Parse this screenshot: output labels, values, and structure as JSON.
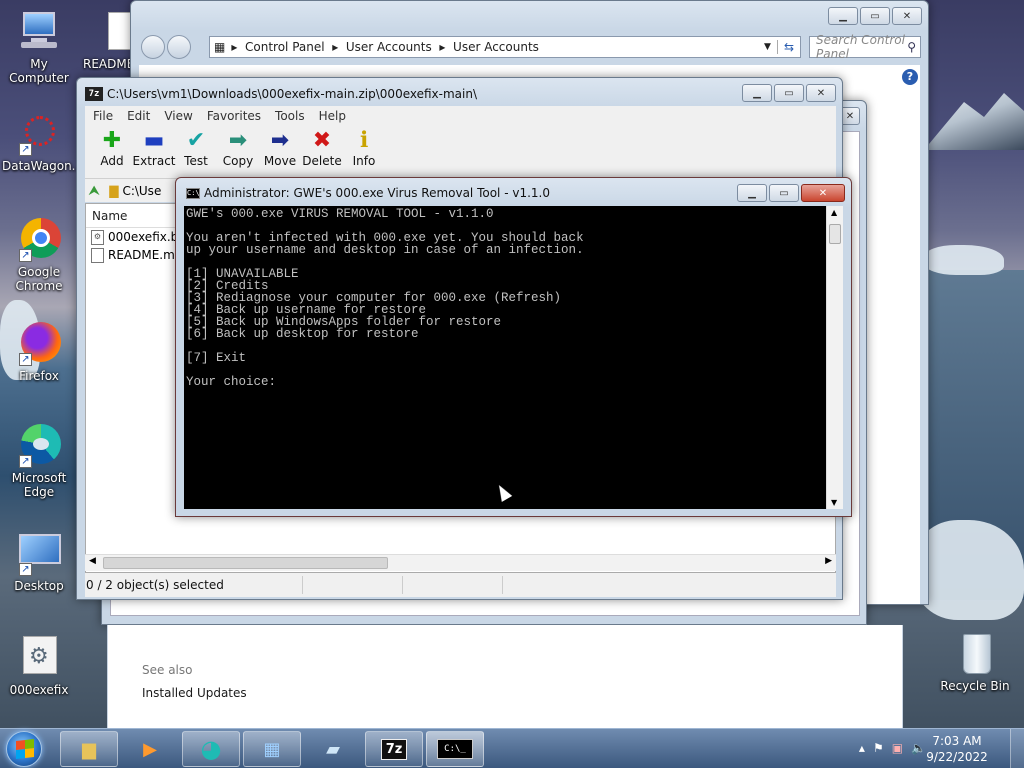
{
  "desktop": {
    "icons": [
      {
        "label": "My Computer",
        "icon": "computer-icon"
      },
      {
        "label": "README",
        "icon": "document-icon"
      },
      {
        "label": "DataWagon...",
        "icon": "datawagon-icon"
      },
      {
        "label": "Google Chrome",
        "icon": "chrome-icon"
      },
      {
        "label": "Firefox",
        "icon": "firefox-icon"
      },
      {
        "label": "Microsoft Edge",
        "icon": "edge-icon"
      },
      {
        "label": "Desktop",
        "icon": "monitor-icon"
      },
      {
        "label": "000exefix",
        "icon": "gear-file-icon"
      },
      {
        "label": "Recycle Bin",
        "icon": "recycle-bin-icon"
      }
    ]
  },
  "control_panel": {
    "breadcrumb": [
      "Control Panel",
      "User Accounts",
      "User Accounts"
    ],
    "search_placeholder": "Search Control Panel",
    "see_also": "See also",
    "installed_updates": "Installed Updates"
  },
  "sevenzip": {
    "title": "C:\\Users\\vm1\\Downloads\\000exefix-main.zip\\000exefix-main\\",
    "menu": [
      "File",
      "Edit",
      "View",
      "Favorites",
      "Tools",
      "Help"
    ],
    "toolbar": [
      {
        "label": "Add",
        "icon": "plus-icon",
        "color": "#19a619",
        "glyph": "✚"
      },
      {
        "label": "Extract",
        "icon": "minus-icon",
        "color": "#1e3fbf",
        "glyph": "▬"
      },
      {
        "label": "Test",
        "icon": "check-icon",
        "color": "#17a3a3",
        "glyph": "✔"
      },
      {
        "label": "Copy",
        "icon": "copy-arrow-icon",
        "color": "#2a8f7a",
        "glyph": "➡"
      },
      {
        "label": "Move",
        "icon": "move-arrow-icon",
        "color": "#1e2f8f",
        "glyph": "➡"
      },
      {
        "label": "Delete",
        "icon": "delete-x-icon",
        "color": "#d01818",
        "glyph": "✖"
      },
      {
        "label": "Info",
        "icon": "info-icon",
        "color": "#c9a300",
        "glyph": "ℹ"
      }
    ],
    "path": "C:\\Use",
    "column_name": "Name",
    "files": [
      "000exefix.bat",
      "README.md"
    ],
    "status": "0 / 2 object(s) selected"
  },
  "console": {
    "title": "Administrator:  GWE's 000.exe Virus Removal Tool - v1.1.0",
    "lines": [
      "GWE's 000.exe VIRUS REMOVAL TOOL - v1.1.0",
      "",
      "You aren't infected with 000.exe yet. You should back",
      "up your username and desktop in case of an infection.",
      "",
      "[1] UNAVAILABLE",
      "[2] Credits",
      "[3] Rediagnose your computer for 000.exe (Refresh)",
      "[4] Back up username for restore",
      "[5] Back up WindowsApps folder for restore",
      "[6] Back up desktop for restore",
      "",
      "[7] Exit",
      "",
      "Your choice:"
    ]
  },
  "taskbar": {
    "apps": [
      "explorer-icon",
      "media-player-icon",
      "edge-icon",
      "control-panel-icon",
      "notepad-icon",
      "7zip-icon",
      "cmd-icon"
    ],
    "time": "7:03 AM",
    "date": "9/22/2022",
    "sevenzip_label": "7z"
  }
}
